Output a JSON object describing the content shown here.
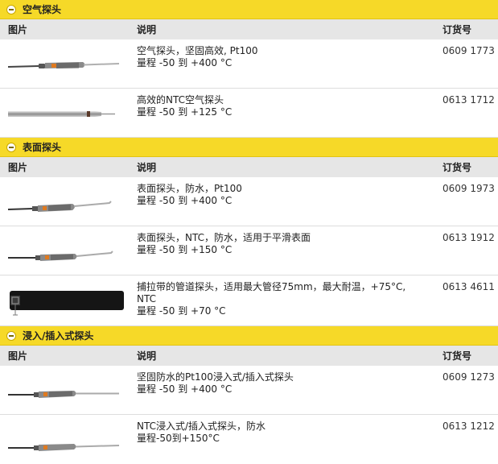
{
  "columns": {
    "image": "图片",
    "description": "说明",
    "order_no": "订货号"
  },
  "sections": [
    {
      "title": "空气探头",
      "rows": [
        {
          "line1": "空气探头，坚固高效, Pt100",
          "line2": "量程 -50 到 +400 °C",
          "order": "0609 1773",
          "image": "air-probe-pt100-image"
        },
        {
          "line1": "高效的NTC空气探头",
          "line2": "量程 -50 到 +125 °C",
          "order": "0613 1712",
          "image": "ntc-air-probe-image"
        }
      ]
    },
    {
      "title": "表面探头",
      "rows": [
        {
          "line1": "表面探头，防水，Pt100",
          "line2": "量程 -50 到 +400 °C",
          "order": "0609 1973",
          "image": "surface-probe-pt100-image"
        },
        {
          "line1": "表面探头，NTC，防水，适用于平滑表面",
          "line2": "量程 -50 到 +150 °C",
          "order": "0613 1912",
          "image": "surface-probe-ntc-image"
        },
        {
          "line1": "捕拉带的管道探头，适用最大管径75mm，最大耐温，+75°C,",
          "line1b": "NTC",
          "line2": "量程 -50 到 +70 °C",
          "order": "0613 4611",
          "image": "pipe-strap-probe-image"
        }
      ]
    },
    {
      "title": "浸入/插入式探头",
      "rows": [
        {
          "line1": "坚固防水的Pt100浸入式/插入式探头",
          "line2": "量程 -50 到 +400 °C",
          "order": "0609 1273",
          "image": "immersion-probe-pt100-image"
        },
        {
          "line1": "NTC浸入式/插入式探头，防水",
          "line2": "量程-50到+150°C",
          "order": "0613 1212",
          "image": "immersion-probe-ntc-image"
        }
      ]
    }
  ],
  "colors": {
    "header_yellow": "#f6d928",
    "column_header_grey": "#e6e6e6",
    "handle_grey": "#7d7d7d",
    "tip_orange": "#e07a1f"
  }
}
